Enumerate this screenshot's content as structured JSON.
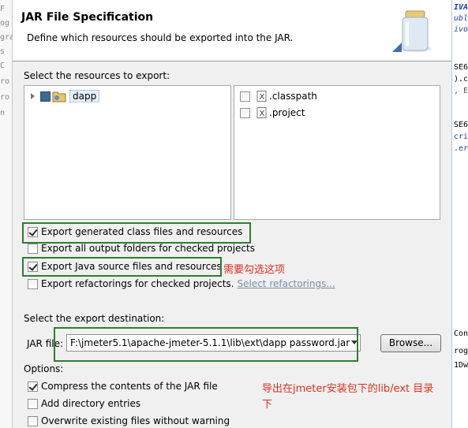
{
  "dialog": {
    "title": "JAR File Specification",
    "description": "Define which resources should be exported into the JAR."
  },
  "resources": {
    "label": "Select the resources to export:",
    "project_name": "dapp",
    "files": [
      {
        "name": ".classpath",
        "checked": false
      },
      {
        "name": ".project",
        "checked": false
      }
    ]
  },
  "options_top": {
    "export_class_files": {
      "label": "Export generated class files and resources",
      "checked": true
    },
    "export_output_folders": {
      "label": "Export all output folders for checked projects",
      "checked": false
    },
    "export_java_source": {
      "label": "Export Java source files and resources",
      "checked": true
    },
    "export_refactorings": {
      "label": "Export refactorings for checked projects.",
      "checked": false
    },
    "select_refactorings_link": "Select refactorings..."
  },
  "destination": {
    "label": "Select the export destination:",
    "jar_file_label": "JAR file:",
    "jar_file_value": "F:\\jmeter5.1\\apache-jmeter-5.1.1\\lib\\ext\\dapp password.jar",
    "browse_label": "Browse..."
  },
  "options": {
    "label": "Options:",
    "compress": {
      "label": "Compress the contents of the JAR file",
      "checked": true
    },
    "add_directory": {
      "label": "Add directory entries",
      "checked": false
    },
    "overwrite": {
      "label": "Overwrite existing files without warning",
      "checked": false
    }
  },
  "annotations": {
    "check_note": "需要勾选这项",
    "export_note_line1": "导出在jmeter安装包下的lib/ext 目录",
    "export_note_line2": "下"
  },
  "background": {
    "left_fragments": [
      "F",
      "og",
      "gra",
      "s",
      "C",
      "ro",
      "ro",
      "n"
    ],
    "right_fragments": [
      "IVA",
      "ubl",
      "ivo",
      "SE6",
      ").c",
      ", E",
      "SE6",
      "cri",
      ".er",
      "Con",
      "rog",
      "1Dw"
    ]
  },
  "colors": {
    "annotation_red": "#e0301e",
    "highlight_green": "#2e7d32",
    "link": "#7b8da8"
  }
}
